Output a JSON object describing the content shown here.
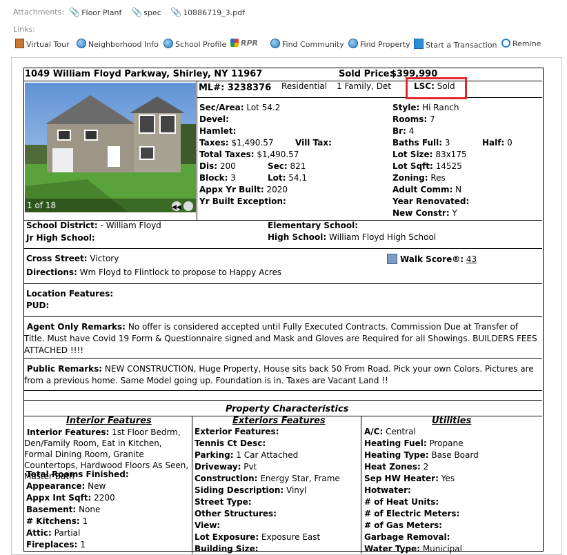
{
  "attachments": {
    "label": "Attachments:",
    "files": [
      "Floor Planf",
      "spec",
      "10886719_3.pdf"
    ]
  },
  "links": {
    "label": "Links:",
    "items": [
      {
        "label": "Virtual Tour",
        "icon": "virtual-tour-icon"
      },
      {
        "label": "Neighborhood Info",
        "icon": "globe-icon"
      },
      {
        "label": "School Profile",
        "icon": "globe-icon"
      },
      {
        "label": "RPR",
        "icon": "rpr-logo"
      },
      {
        "label": "Find Community",
        "icon": "globe-icon"
      },
      {
        "label": "Find Property",
        "icon": "globe-icon"
      },
      {
        "label": "Start a Transaction",
        "icon": "transaction-icon"
      },
      {
        "label": "Remine",
        "icon": "remine-icon"
      }
    ]
  },
  "listing": {
    "address": "1049 William Floyd Parkway, Shirley, NY 11967",
    "sold_price_label": "Sold Price:",
    "sold_price": "$399,990",
    "ml_label": "ML#:",
    "ml": "3238376",
    "class": "Residential",
    "type": "1 Family, Det",
    "lsc_label": "LSC:",
    "lsc": "Sold",
    "photo_counter": "1 of 18"
  },
  "mid_left": [
    {
      "label": "Sec/Area:",
      "value": "Lot 54.2"
    },
    {
      "label": "Devel:",
      "value": ""
    },
    {
      "label": "Hamlet:",
      "value": ""
    },
    {
      "label": "Taxes:",
      "value": "$1,490.57"
    },
    {
      "label": "Total Taxes:",
      "value": "$1,490.57"
    },
    {
      "label": "Dis:",
      "value": "200"
    },
    {
      "label": "Block:",
      "value": "3"
    },
    {
      "label": "Appx Yr Built:",
      "value": "2020"
    },
    {
      "label": "Yr Built Exception:",
      "value": ""
    }
  ],
  "mid_center": {
    "vill_tax_label": "Vill Tax:",
    "vill_tax": "",
    "sec_label": "Sec:",
    "sec": "821",
    "lot_label": "Lot:",
    "lot": "54.1"
  },
  "mid_right": [
    {
      "label": "Style:",
      "value": "Hi Ranch"
    },
    {
      "label": "Rooms:",
      "value": "7"
    },
    {
      "label": "Br:",
      "value": "4"
    },
    {
      "label": "Baths Full:",
      "value": "3"
    },
    {
      "label": "Lot Size:",
      "value": "83x175"
    },
    {
      "label": "Lot Sqft:",
      "value": "14525"
    },
    {
      "label": "Zoning:",
      "value": "Res"
    },
    {
      "label": "Adult Comm:",
      "value": "N"
    },
    {
      "label": "Year Renovated:",
      "value": ""
    },
    {
      "label": "New Constr:",
      "value": "Y"
    }
  ],
  "half": {
    "label": "Half:",
    "value": "0"
  },
  "schools": {
    "district_label": "School District:",
    "district": "- William Floyd",
    "jr_label": "Jr High School:",
    "jr": "",
    "elem_label": "Elementary School:",
    "elem": "",
    "high_label": "High School:",
    "high": "William Floyd High School"
  },
  "cross": {
    "cross_label": "Cross Street:",
    "cross": "Victory",
    "dir_label": "Directions:",
    "dir": "Wm Floyd to Flintlock to propose to Happy Acres",
    "walk_label": "Walk Score®:",
    "walk": "43"
  },
  "location": {
    "label": "Location Features:",
    "pud_label": "PUD:"
  },
  "agent_remarks": {
    "label": "Agent Only Remarks:",
    "text": "No offer is considered accepted until Fully Executed Contracts. Commission Due at Transfer of Title. Must have Covid 19 Form & Questionnaire signed and Mask and Gloves are Required for all Showings. BUILDERS FEES ATTACHED !!!!"
  },
  "public_remarks": {
    "label": "Public Remarks:",
    "text": "NEW CONSTRUCTION, Huge Property, House sits back 50 From Road. Pick your own Colors. Pictures are from a previous home. Same Model going up. Foundation is in. Taxes are Vacant Land !!"
  },
  "characteristics_title": "Property Characteristics",
  "interior": {
    "title": "Interior Features",
    "features_label": "Interior Features:",
    "features": "1st Floor Bedrm, Den/Family Room, Eat in Kitchen, Formal Dining Room, Granite Countertops, Hardwood Floors As Seen, Master Bath",
    "rows": [
      {
        "label": "Total Rooms Finished:",
        "value": ""
      },
      {
        "label": "Appearance:",
        "value": "New"
      },
      {
        "label": "Appx Int Sqft:",
        "value": "2200"
      },
      {
        "label": "Basement:",
        "value": "None"
      },
      {
        "label": "# Kitchens:",
        "value": "1"
      },
      {
        "label": "Attic:",
        "value": "Partial"
      },
      {
        "label": "Fireplaces:",
        "value": "1"
      }
    ]
  },
  "exterior": {
    "title": "Exteriors Features",
    "rows": [
      {
        "label": "Exterior Features:",
        "value": ""
      },
      {
        "label": "Tennis Ct Desc:",
        "value": ""
      },
      {
        "label": "Parking:",
        "value": "1 Car Attached"
      },
      {
        "label": "Driveway:",
        "value": "Pvt"
      },
      {
        "label": "Construction:",
        "value": "Energy Star, Frame"
      },
      {
        "label": "Siding Description:",
        "value": "Vinyl"
      },
      {
        "label": "Street Type:",
        "value": ""
      },
      {
        "label": "Other Structures:",
        "value": ""
      },
      {
        "label": "View:",
        "value": ""
      },
      {
        "label": "Lot Exposure:",
        "value": "Exposure East"
      },
      {
        "label": "Building Size:",
        "value": ""
      }
    ]
  },
  "utilities": {
    "title": "Utilities",
    "rows": [
      {
        "label": "A/C:",
        "value": "Central"
      },
      {
        "label": "Heating Fuel:",
        "value": "Propane"
      },
      {
        "label": "Heating Type:",
        "value": "Base Board"
      },
      {
        "label": "Heat Zones:",
        "value": "2"
      },
      {
        "label": "Sep HW Heater:",
        "value": "Yes"
      },
      {
        "label": "Hotwater:",
        "value": ""
      },
      {
        "label": "# of Heat Units:",
        "value": ""
      },
      {
        "label": "# of Electric Meters:",
        "value": ""
      },
      {
        "label": "# of Gas Meters:",
        "value": ""
      },
      {
        "label": "Garbage Removal:",
        "value": ""
      },
      {
        "label": "Water Type:",
        "value": "Municipal"
      }
    ]
  }
}
